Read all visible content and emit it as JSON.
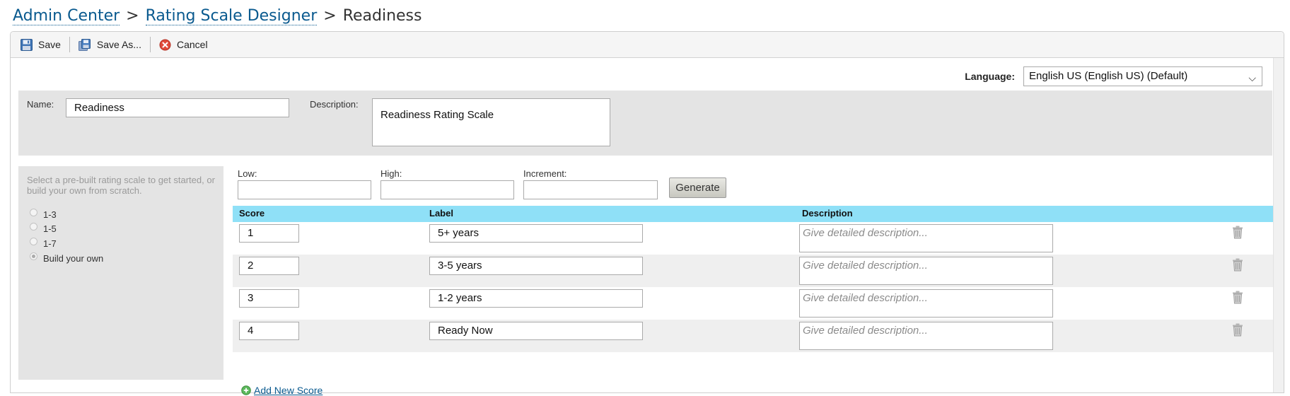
{
  "breadcrumb": {
    "items": [
      "Admin Center",
      "Rating Scale Designer"
    ],
    "separator": ">",
    "current": "Readiness"
  },
  "toolbar": {
    "save_label": "Save",
    "save_as_label": "Save As...",
    "cancel_label": "Cancel"
  },
  "language": {
    "label": "Language:",
    "value": "English US (English US) (Default)"
  },
  "form": {
    "name_label": "Name:",
    "name_value": "Readiness",
    "description_label": "Description:",
    "description_value": "Readiness Rating Scale"
  },
  "prebuilt": {
    "hint": "Select a pre-built rating scale to get started, or build your own from scratch.",
    "options": [
      "1-3",
      "1-5",
      "1-7",
      "Build your own"
    ],
    "selected": "Build your own"
  },
  "generator": {
    "low_label": "Low:",
    "high_label": "High:",
    "increment_label": "Increment:",
    "low_value": "",
    "high_value": "",
    "increment_value": "",
    "generate_label": "Generate"
  },
  "table": {
    "headers": {
      "score": "Score",
      "label": "Label",
      "description": "Description"
    },
    "description_placeholder": "Give detailed description...",
    "rows": [
      {
        "score": "1",
        "label": "5+ years",
        "description": ""
      },
      {
        "score": "2",
        "label": "3-5 years",
        "description": ""
      },
      {
        "score": "3",
        "label": "1-2 years",
        "description": ""
      },
      {
        "score": "4",
        "label": "Ready Now",
        "description": ""
      }
    ]
  },
  "add_new_label": "Add New Score",
  "colors": {
    "link": "#0a5a8f",
    "table_header": "#8fe0f7",
    "panel_gray": "#e4e4e4"
  }
}
